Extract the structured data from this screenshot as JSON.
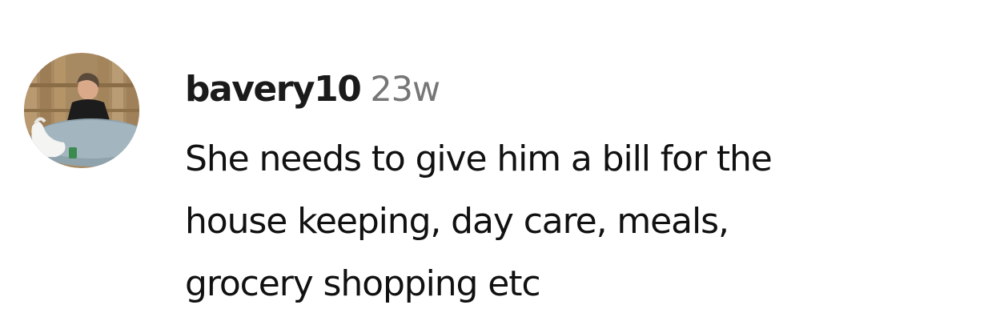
{
  "comment": {
    "avatar_icon": "user-avatar-photo",
    "username": "bavery10",
    "timestamp": "23w",
    "text_lines": [
      "She needs to give him a bill for the",
      "house keeping, day care, meals,",
      "grocery shopping etc"
    ]
  },
  "colors": {
    "username": "#1a1a1a",
    "timestamp": "#767676",
    "text": "#111111",
    "background": "#ffffff"
  }
}
